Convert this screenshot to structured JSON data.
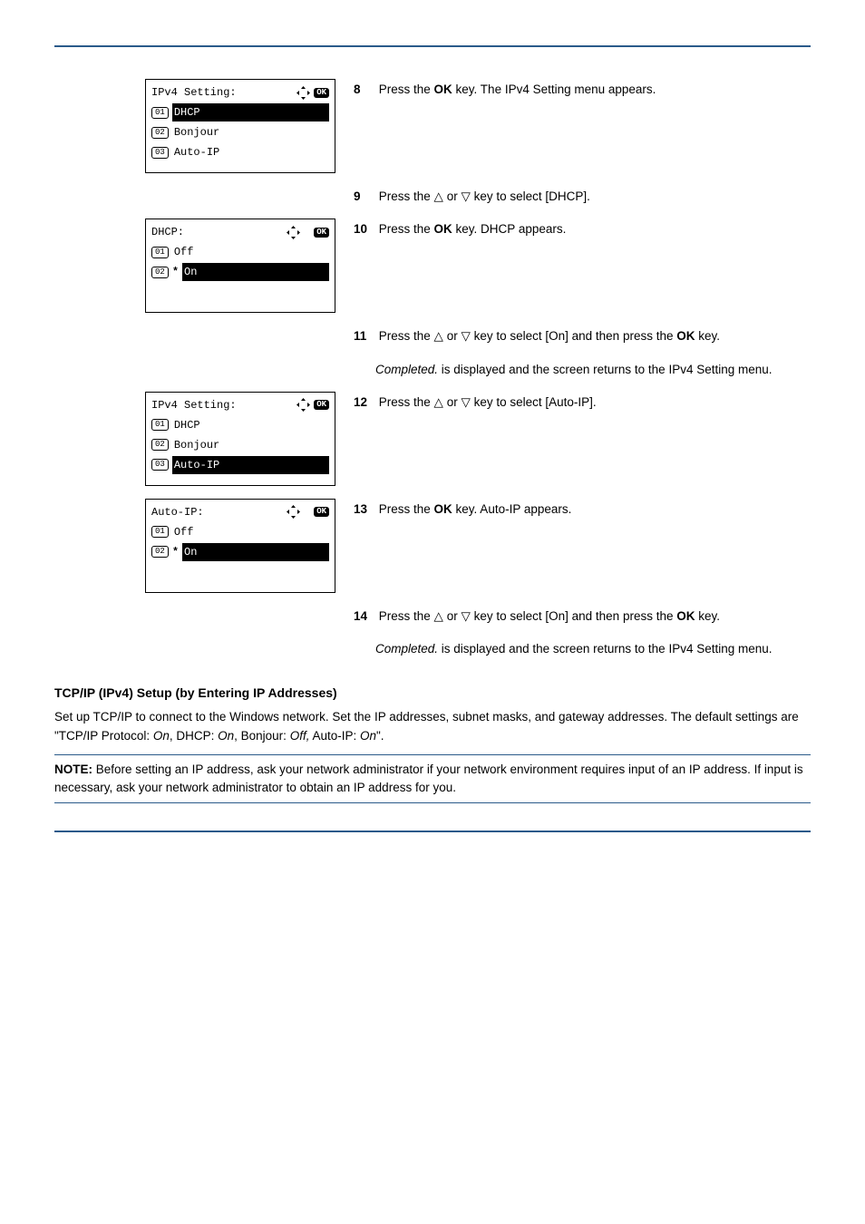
{
  "lcd1": {
    "title": "IPv4 Setting:",
    "line1": "DHCP",
    "line2": "Bonjour",
    "line3": "Auto-IP"
  },
  "lcd2": {
    "title": "DHCP:",
    "line1": "Off",
    "line2": "On"
  },
  "lcd3": {
    "title": "IPv4 Setting:",
    "line1": "DHCP",
    "line2": "Bonjour",
    "line3": "Auto-IP"
  },
  "lcd4": {
    "title": "Auto-IP:",
    "line1": "Off",
    "line2": "On"
  },
  "steps": {
    "s8": {
      "num": "8",
      "text_a": "Press the ",
      "key": "OK",
      "text_b": " key. The IPv4 Setting menu appears."
    },
    "s9": {
      "num": "9",
      "text_a": "Press the ",
      "text_b": " or ",
      "text_c": " key to select [DHCP]."
    },
    "s10": {
      "num": "10",
      "text_a": "Press the ",
      "key": "OK",
      "text_b": " key. DHCP appears."
    },
    "s11": {
      "num": "11",
      "text_a": "Press the ",
      "text_b": " or ",
      "text_c": " key to select [On] and then press the ",
      "key": "OK",
      "text_d": " key."
    },
    "s11b": {
      "ital": "Completed.",
      "text": " is displayed and the screen returns to the IPv4 Setting menu."
    },
    "s12": {
      "num": "12",
      "text_a": "Press the ",
      "text_b": " or ",
      "text_c": " key to select [Auto-IP]."
    },
    "s13": {
      "num": "13",
      "text_a": "Press the ",
      "key": "OK",
      "text_b": " key. Auto-IP appears."
    },
    "s14": {
      "num": "14",
      "text_a": "Press the ",
      "text_b": " or ",
      "text_c": " key to select [On] and then press the ",
      "key": "OK",
      "text_d": " key."
    },
    "s14b": {
      "ital": "Completed.",
      "text": " is displayed and the screen returns to the IPv4 Setting menu."
    }
  },
  "section": {
    "title": "TCP/IP (IPv4) Setup (by Entering IP Addresses)",
    "body_a": "Set up TCP/IP to connect to the Windows network. Set the IP addresses, subnet masks, and gateway addresses. The default settings are \"TCP/IP Protocol: ",
    "on1": "On",
    "body_b": ", DHCP: ",
    "on2": "On",
    "body_c": ", Bonjour: ",
    "off1": "Off,",
    "body_d": " Auto-IP: ",
    "on3": "On",
    "body_e": "\"."
  },
  "note": {
    "label": "NOTE:",
    "text": " Before setting an IP address, ask your network administrator if your network environment requires input of an IP address. If input is necessary, ask your network administrator to obtain an IP address for you."
  }
}
